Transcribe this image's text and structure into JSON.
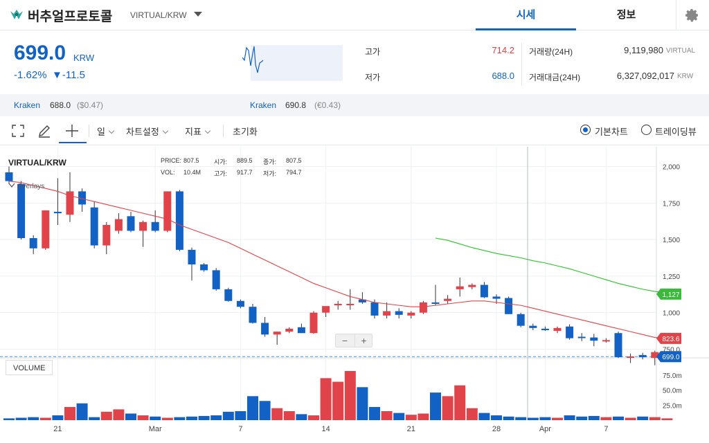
{
  "header": {
    "coin_name": "버추얼프로토콜",
    "pair": "VIRTUAL/KRW",
    "tabs": [
      {
        "label": "시세",
        "active": true
      },
      {
        "label": "정보",
        "active": false
      }
    ],
    "accent_color": "#1261c4"
  },
  "summary": {
    "price": "699.0",
    "unit": "KRW",
    "change_rate": "-1.62%",
    "change_amount": "▼-11.5",
    "high_label": "고가",
    "high_value": "714.2",
    "low_label": "저가",
    "low_value": "688.0",
    "volume_label": "거래량(24H)",
    "volume_value": "9,119,980",
    "volume_unit": "VIRTUAL",
    "amount_label": "거래대금(24H)",
    "amount_value": "6,327,092,017",
    "amount_unit": "KRW"
  },
  "exchanges": [
    {
      "name": "Kraken",
      "price": "688.0",
      "usd": "($0.47)"
    },
    {
      "name": "Kraken",
      "price": "690.8",
      "usd": "(€0.43)"
    }
  ],
  "toolbar": {
    "period": "일",
    "chart_settings": "차트설정",
    "indicators": "지표",
    "reset": "초기화",
    "view_basic": "기본차트",
    "view_tv": "트레이딩뷰"
  },
  "chart": {
    "pair": "VIRTUAL/KRW",
    "overlays_label": "Overlays",
    "info": {
      "price_label": "PRICE:",
      "price": "807.5",
      "open_label": "시가:",
      "open": "889.5",
      "close_label": "종가:",
      "close": "807.5",
      "vol_label": "VOL:",
      "vol": "10.4M",
      "high_label": "고가:",
      "high": "917.7",
      "low_label": "저가:",
      "low": "794.7"
    },
    "volume_label": "VOLUME",
    "price_ticks": [
      "2,000",
      "1,750",
      "1,500",
      "1,250",
      "1,000",
      "750.0"
    ],
    "volume_ticks": [
      "75.0m",
      "50.0m",
      "25.0m"
    ],
    "x_ticks": [
      "21",
      "Mar",
      "7",
      "14",
      "21",
      "28",
      "Apr",
      "7"
    ],
    "badges": {
      "ma_long": "1,127",
      "ma_short": "823.6",
      "last": "699.0"
    },
    "colors": {
      "up": "#e0434a",
      "down": "#1261c4",
      "ma_short": "#e0434a",
      "ma_long": "#2ec02e",
      "last_badge": "#1261c4",
      "long_badge": "#3cb93c",
      "short_badge": "#e0434a"
    }
  },
  "chart_data": {
    "type": "candlestick",
    "y_range": [
      700,
      2050
    ],
    "candles": [
      {
        "o": 1960,
        "h": 2000,
        "l": 1880,
        "c": 1900
      },
      {
        "o": 1880,
        "h": 1900,
        "l": 1500,
        "c": 1510
      },
      {
        "o": 1510,
        "h": 1530,
        "l": 1400,
        "c": 1440
      },
      {
        "o": 1440,
        "h": 1700,
        "l": 1430,
        "c": 1700
      },
      {
        "o": 1690,
        "h": 1920,
        "l": 1600,
        "c": 1680
      },
      {
        "o": 1670,
        "h": 1960,
        "l": 1620,
        "c": 1830
      },
      {
        "o": 1830,
        "h": 1850,
        "l": 1690,
        "c": 1740
      },
      {
        "o": 1720,
        "h": 1760,
        "l": 1440,
        "c": 1460
      },
      {
        "o": 1460,
        "h": 1620,
        "l": 1400,
        "c": 1600
      },
      {
        "o": 1560,
        "h": 1680,
        "l": 1540,
        "c": 1640
      },
      {
        "o": 1660,
        "h": 1690,
        "l": 1550,
        "c": 1560
      },
      {
        "o": 1560,
        "h": 1630,
        "l": 1450,
        "c": 1620
      },
      {
        "o": 1620,
        "h": 1700,
        "l": 1550,
        "c": 1560
      },
      {
        "o": 1560,
        "h": 1830,
        "l": 1550,
        "c": 1830
      },
      {
        "o": 1830,
        "h": 1840,
        "l": 1420,
        "c": 1430
      },
      {
        "o": 1430,
        "h": 1445,
        "l": 1220,
        "c": 1330
      },
      {
        "o": 1330,
        "h": 1340,
        "l": 1280,
        "c": 1290
      },
      {
        "o": 1290,
        "h": 1305,
        "l": 1150,
        "c": 1160
      },
      {
        "o": 1160,
        "h": 1170,
        "l": 1075,
        "c": 1080
      },
      {
        "o": 1080,
        "h": 1090,
        "l": 1030,
        "c": 1040
      },
      {
        "o": 1040,
        "h": 1060,
        "l": 925,
        "c": 930
      },
      {
        "o": 930,
        "h": 970,
        "l": 835,
        "c": 850
      },
      {
        "o": 850,
        "h": 870,
        "l": 780,
        "c": 870
      },
      {
        "o": 870,
        "h": 900,
        "l": 860,
        "c": 890
      },
      {
        "o": 900,
        "h": 925,
        "l": 860,
        "c": 860
      },
      {
        "o": 860,
        "h": 1010,
        "l": 855,
        "c": 1000
      },
      {
        "o": 1000,
        "h": 1040,
        "l": 970,
        "c": 1045
      },
      {
        "o": 1050,
        "h": 1080,
        "l": 1020,
        "c": 1060
      },
      {
        "o": 1060,
        "h": 1160,
        "l": 1020,
        "c": 1060
      },
      {
        "o": 1090,
        "h": 1140,
        "l": 1060,
        "c": 1070
      },
      {
        "o": 1070,
        "h": 1090,
        "l": 960,
        "c": 980
      },
      {
        "o": 980,
        "h": 1070,
        "l": 960,
        "c": 1010
      },
      {
        "o": 1010,
        "h": 1030,
        "l": 960,
        "c": 985
      },
      {
        "o": 980,
        "h": 1010,
        "l": 960,
        "c": 1000
      },
      {
        "o": 1000,
        "h": 1080,
        "l": 990,
        "c": 1070
      },
      {
        "o": 1070,
        "h": 1190,
        "l": 1050,
        "c": 1060
      },
      {
        "o": 1080,
        "h": 1120,
        "l": 1060,
        "c": 1095
      },
      {
        "o": 1160,
        "h": 1240,
        "l": 1110,
        "c": 1180
      },
      {
        "o": 1175,
        "h": 1200,
        "l": 1160,
        "c": 1190
      },
      {
        "o": 1190,
        "h": 1210,
        "l": 1100,
        "c": 1105
      },
      {
        "o": 1110,
        "h": 1125,
        "l": 1060,
        "c": 1095
      },
      {
        "o": 1100,
        "h": 1110,
        "l": 990,
        "c": 990
      },
      {
        "o": 990,
        "h": 1000,
        "l": 900,
        "c": 910
      },
      {
        "o": 910,
        "h": 925,
        "l": 880,
        "c": 895
      },
      {
        "o": 890,
        "h": 905,
        "l": 875,
        "c": 880
      },
      {
        "o": 875,
        "h": 905,
        "l": 860,
        "c": 895
      },
      {
        "o": 905,
        "h": 920,
        "l": 815,
        "c": 825
      },
      {
        "o": 835,
        "h": 860,
        "l": 805,
        "c": 830
      },
      {
        "o": 830,
        "h": 855,
        "l": 770,
        "c": 808
      },
      {
        "o": 808,
        "h": 825,
        "l": 795,
        "c": 812
      },
      {
        "o": 860,
        "h": 870,
        "l": 690,
        "c": 695
      },
      {
        "o": 695,
        "h": 720,
        "l": 655,
        "c": 700
      },
      {
        "o": 710,
        "h": 725,
        "l": 680,
        "c": 695
      },
      {
        "o": 690,
        "h": 740,
        "l": 640,
        "c": 730
      },
      {
        "o": 700,
        "h": 715,
        "l": 695,
        "c": 710
      }
    ],
    "volumes": [
      3,
      4,
      5,
      4,
      8,
      22,
      28,
      5,
      14,
      18,
      11,
      8,
      6,
      4,
      5,
      6,
      7,
      8,
      14,
      15,
      40,
      32,
      20,
      15,
      10,
      8,
      70,
      64,
      82,
      55,
      22,
      15,
      12,
      9,
      11,
      46,
      40,
      58,
      20,
      12,
      8,
      6,
      5,
      4,
      5,
      4,
      8,
      6,
      7,
      5,
      6,
      4,
      6,
      5,
      3
    ],
    "volume_range": [
      0,
      90
    ],
    "ma_short": [
      1900,
      1890,
      1870,
      1850,
      1830,
      1800,
      1780,
      1760,
      1740,
      1720,
      1700,
      1680,
      1660,
      1640,
      1600,
      1570,
      1540,
      1510,
      1480,
      1440,
      1400,
      1360,
      1320,
      1280,
      1240,
      1200,
      1170,
      1140,
      1110,
      1090,
      1070,
      1060,
      1050,
      1040,
      1040,
      1050,
      1060,
      1070,
      1080,
      1080,
      1070,
      1060,
      1050,
      1030,
      1010,
      990,
      970,
      950,
      930,
      910,
      890,
      870,
      850,
      830,
      823.6
    ],
    "ma_long_start": 35,
    "ma_long": [
      1510,
      1495,
      1470,
      1445,
      1425,
      1405,
      1390,
      1375,
      1355,
      1340,
      1320,
      1300,
      1275,
      1250,
      1225,
      1200,
      1180,
      1160,
      1145,
      1135,
      1127
    ]
  }
}
